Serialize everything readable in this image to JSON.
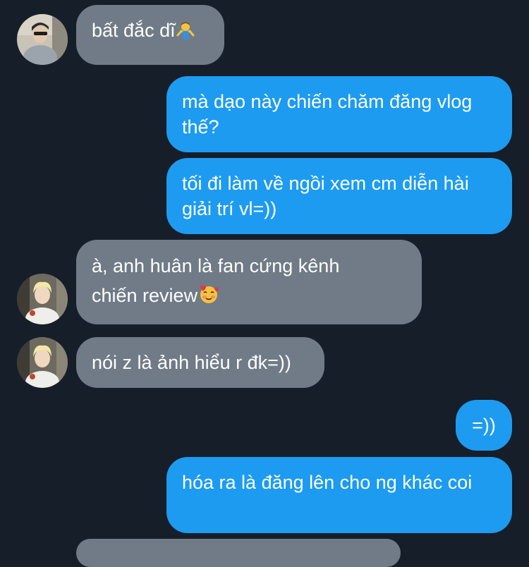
{
  "messages": [
    {
      "direction": "incoming",
      "text": "bất đắc dĩ",
      "emoji": "person-shrugging-emoji",
      "avatar": "avatar-1"
    },
    {
      "direction": "outgoing",
      "text": "mà dạo này chiến chăm đăng vlog thế?"
    },
    {
      "direction": "outgoing",
      "text": "tối đi làm về ngồi xem cm diễn hài giải trí vl=))"
    },
    {
      "direction": "incoming",
      "text_line1": "à, anh huân là fan cứng kênh",
      "text_line2": "chiến review",
      "emoji": "smiling-face-with-hearts-emoji",
      "avatar": "avatar-2"
    },
    {
      "direction": "incoming",
      "text": "nói z là ảnh hiểu r đk=))",
      "avatar": "avatar-2"
    },
    {
      "direction": "outgoing",
      "text": "=))"
    },
    {
      "direction": "outgoing",
      "text": "hóa ra là đăng lên cho ng khác coi"
    }
  ],
  "colors": {
    "background": "#161e29",
    "incoming_bubble": "#707b87",
    "outgoing_bubble": "#1d9bf0",
    "text": "#ffffff"
  }
}
